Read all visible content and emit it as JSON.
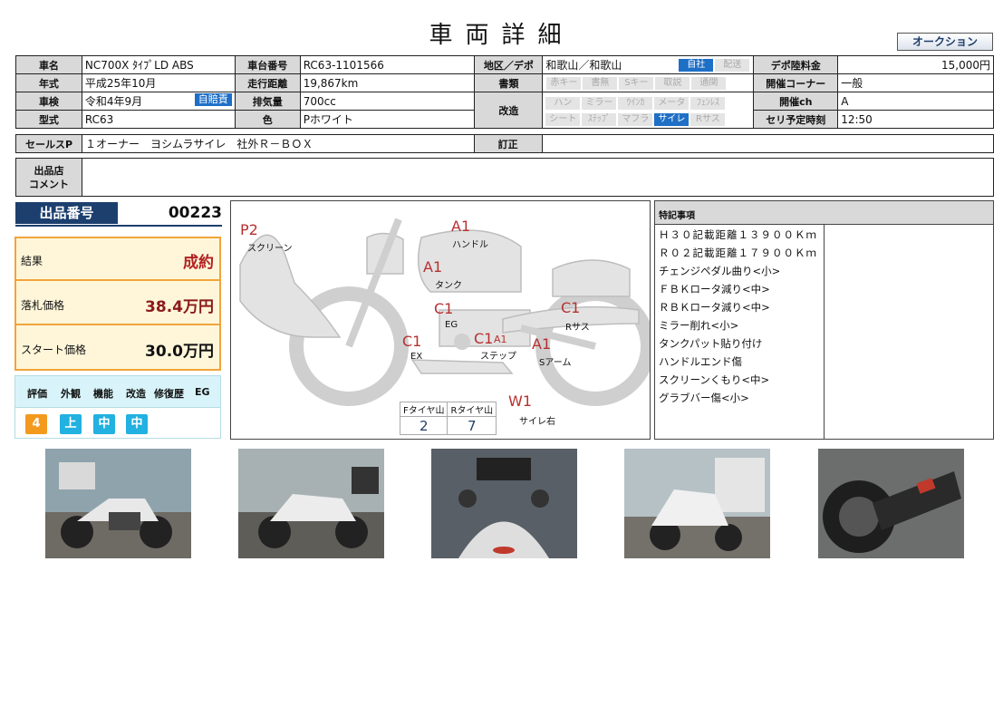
{
  "header": {
    "title": "車両詳細",
    "auction_button": "オークション"
  },
  "spec": {
    "name_label": "車名",
    "name": "NC700X ﾀｲﾌﾟLD ABS",
    "frame_label": "車台番号",
    "frame": "RC63-1101566",
    "area_label": "地区／デポ",
    "area": "和歌山／和歌山",
    "area_badge_on": "自社",
    "area_badge_off": "配送",
    "fee_label": "デポ陸料金",
    "fee": "15,000円",
    "year_label": "年式",
    "year": "平成25年10月",
    "mileage_label": "走行距離",
    "mileage": "19,867km",
    "docs_label": "書類",
    "docs_pills": [
      {
        "text": "赤キー",
        "on": false
      },
      {
        "text": "書無",
        "on": false
      },
      {
        "text": "Sキー",
        "on": false
      },
      {
        "text": "取説",
        "on": false
      },
      {
        "text": "通関",
        "on": false
      }
    ],
    "corner_label": "開催コーナー",
    "corner": "一般",
    "inspection_label": "車検",
    "inspection": "令和4年9月",
    "inspection_badge": "自賠責",
    "displacement_label": "排気量",
    "displacement": "700cc",
    "mod_label": "改造",
    "mod_pills_row1": [
      {
        "text": "ハン",
        "on": false
      },
      {
        "text": "ミラー",
        "on": false
      },
      {
        "text": "ｳｲﾝｶ",
        "on": false
      },
      {
        "text": "メータ",
        "on": false
      },
      {
        "text": "ﾌｪﾝﾚｽ",
        "on": false
      }
    ],
    "mod_pills_row2": [
      {
        "text": "シート",
        "on": false
      },
      {
        "text": "ｽﾃｯﾌﾟ",
        "on": false
      },
      {
        "text": "マフラ",
        "on": false
      },
      {
        "text": "サイレ",
        "on": true
      },
      {
        "text": "Rサス",
        "on": false
      }
    ],
    "channel_label": "開催ch",
    "channel": "A",
    "model_label": "型式",
    "model": "RC63",
    "color_label": "色",
    "color": "Pホワイト",
    "time_label": "セリ予定時刻",
    "time": "12:50",
    "salespoint_label": "セールスP",
    "salespoint": "１オーナー　ヨシムラサイレ　社外Ｒ－ＢＯＸ",
    "correction_label": "訂正",
    "correction": "",
    "comment_label": "出品店コメント",
    "comment_label_1": "出品店",
    "comment_label_2": "コメント",
    "comment": ""
  },
  "lot": {
    "label": "出品番号",
    "number": "00223"
  },
  "prices": {
    "result_label": "結果",
    "result": "成約",
    "winning_label": "落札価格",
    "winning": "38.4万円",
    "start_label": "スタート価格",
    "start": "30.0万円"
  },
  "rating": {
    "headers": [
      "評価",
      "外観",
      "機能",
      "改造",
      "修復歴",
      "EG"
    ],
    "values": [
      {
        "text": "4",
        "color": "#f39a1e"
      },
      {
        "text": "上",
        "color": "#22b1e0"
      },
      {
        "text": "中",
        "color": "#22b1e0"
      },
      {
        "text": "中",
        "color": "#22b1e0"
      }
    ]
  },
  "diagram": {
    "marks": [
      {
        "code": "P2",
        "label": "スクリーン"
      },
      {
        "code": "A1",
        "label": "ハンドル"
      },
      {
        "code": "A1",
        "label": "タンク"
      },
      {
        "code": "C1",
        "label": "EG"
      },
      {
        "code": "C1",
        "label": "Rサス"
      },
      {
        "code": "C1",
        "label": "EX"
      },
      {
        "code": "C1",
        "code2": "A1",
        "label": "ステップ"
      },
      {
        "code": "A1",
        "label": "Sアーム"
      },
      {
        "code": "W1",
        "label": "サイレ右"
      }
    ],
    "tyre_f_label": "Fタイヤ山",
    "tyre_f": "2",
    "tyre_r_label": "Rタイヤ山",
    "tyre_r": "7"
  },
  "notes": {
    "header": "特記事項",
    "items": [
      "Ｈ３０記載距離１３９００Ｋｍ",
      "Ｒ０２記載距離１７９００Ｋｍ",
      "チェンジペダル曲り<小>",
      "ＦＢＫロータ減り<中>",
      "ＲＢＫロータ減り<中>",
      "ミラー削れ<小>",
      "タンクパット貼り付け",
      "ハンドルエンド傷",
      "スクリーンくもり<中>",
      "グラブバー傷<小>"
    ]
  }
}
